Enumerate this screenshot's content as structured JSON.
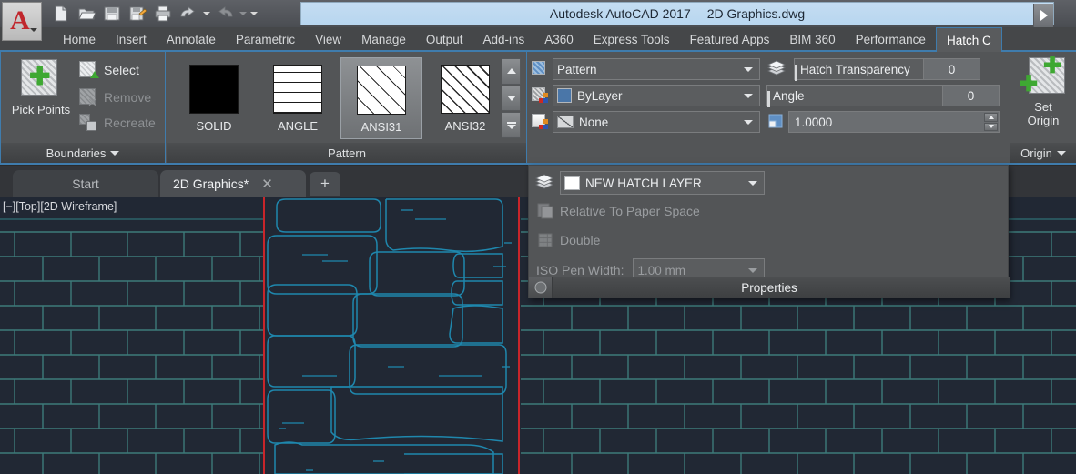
{
  "window": {
    "app_title": "Autodesk AutoCAD 2017",
    "document_title": "2D Graphics.dwg",
    "app_button_glyph": "A"
  },
  "quick_access": {
    "items": [
      {
        "name": "new-icon",
        "label": "New"
      },
      {
        "name": "open-icon",
        "label": "Open"
      },
      {
        "name": "save-icon",
        "label": "Save"
      },
      {
        "name": "save-as-icon",
        "label": "Save As"
      },
      {
        "name": "plot-icon",
        "label": "Plot"
      },
      {
        "name": "undo-icon",
        "label": "Undo"
      },
      {
        "name": "redo-icon",
        "label": "Redo"
      }
    ]
  },
  "ribbon_tabs": [
    {
      "label": "Home",
      "active": false
    },
    {
      "label": "Insert",
      "active": false
    },
    {
      "label": "Annotate",
      "active": false
    },
    {
      "label": "Parametric",
      "active": false
    },
    {
      "label": "View",
      "active": false
    },
    {
      "label": "Manage",
      "active": false
    },
    {
      "label": "Output",
      "active": false
    },
    {
      "label": "Add-ins",
      "active": false
    },
    {
      "label": "A360",
      "active": false
    },
    {
      "label": "Express Tools",
      "active": false
    },
    {
      "label": "Featured Apps",
      "active": false
    },
    {
      "label": "BIM 360",
      "active": false
    },
    {
      "label": "Performance",
      "active": false
    },
    {
      "label": "Hatch C",
      "active": true
    }
  ],
  "boundaries_panel": {
    "title": "Boundaries",
    "pick_points_label": "Pick Points",
    "select_label": "Select",
    "remove_label": "Remove",
    "recreate_label": "Recreate"
  },
  "pattern_panel": {
    "title": "Pattern",
    "patterns": [
      {
        "label": "SOLID",
        "selected": false
      },
      {
        "label": "ANGLE",
        "selected": false
      },
      {
        "label": "ANSI31",
        "selected": true
      },
      {
        "label": "ANSI32",
        "selected": false
      }
    ]
  },
  "properties_panel": {
    "title": "Properties",
    "hatch_type": "Pattern",
    "hatch_color": "ByLayer",
    "background_color": "None",
    "transparency_label": "Hatch Transparency",
    "transparency_value": "0",
    "angle_label": "Angle",
    "angle_value": "0",
    "scale_value": "1.0000"
  },
  "properties_flyout": {
    "title": "Properties",
    "layer": "NEW HATCH LAYER",
    "relative_to_paper_space": "Relative To Paper Space",
    "double": "Double",
    "iso_pen_width_label": "ISO Pen Width:",
    "iso_pen_width_value": "1.00 mm"
  },
  "origin_panel": {
    "title": "Origin",
    "set_origin_label_line1": "Set",
    "set_origin_label_line2": "Origin"
  },
  "document_tabs": [
    {
      "label": "Start",
      "active": false,
      "closable": false
    },
    {
      "label": "2D Graphics*",
      "active": true,
      "closable": true
    }
  ],
  "new_tab_glyph": "+",
  "canvas": {
    "viewport_label": "[−][Top][2D Wireframe]",
    "background_color": "#212834",
    "hatch_line_color": "#3d7a7a",
    "stone_line_color": "#1f87ad",
    "boundary_color": "#c8252a"
  }
}
